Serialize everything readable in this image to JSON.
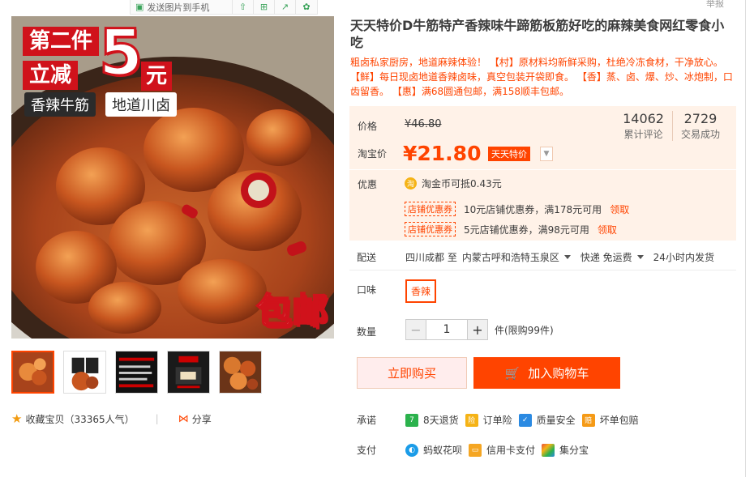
{
  "toolbar": {
    "send_to_phone": "发送图片到手机",
    "top_right_link": "举报"
  },
  "main_image": {
    "promo_line1": "第二件",
    "promo_line2": "立减",
    "promo_big": "5",
    "promo_yuan": "元",
    "tag_spicy": "香辣牛筋",
    "tag_local": "地道川卤",
    "tag_free_shipping": "包邮"
  },
  "thumbnails": [
    "thumb-1",
    "thumb-2",
    "thumb-3",
    "thumb-4",
    "thumb-5"
  ],
  "favorite": {
    "label": "收藏宝贝",
    "count": "（33365人气）",
    "share": "分享"
  },
  "product": {
    "title": "天天特价D牛筋特产香辣味牛蹄筋板筋好吃的麻辣美食网红零食小吃",
    "subtitle": "粗卤私家厨房，地道麻辣体验！ 【村】原材料均新鲜采购，杜绝冷冻食材，干净放心。【鲜】每日现卤地道香辣卤味，真空包装开袋即食。 【香】蒸、卤、爆、炒、冰炮制，口齿留香。 【惠】满68圆通包邮，满158顺丰包邮。"
  },
  "price": {
    "label": "价格",
    "original": "¥46.80",
    "tb_label": "淘宝价",
    "current": "¥21.80",
    "badge": "天天特价"
  },
  "stats": {
    "reviews_num": "14062",
    "reviews_label": "累计评论",
    "deals_num": "2729",
    "deals_label": "交易成功"
  },
  "promo": {
    "label": "优惠",
    "coin_icon": "淘",
    "coin_text": "淘金币可抵0.43元",
    "coupons": [
      {
        "tag": "店铺优惠券",
        "text": "10元店铺优惠券，满178元可用",
        "get": "领取"
      },
      {
        "tag": "店铺优惠券",
        "text": "5元店铺优惠券，满98元可用",
        "get": "领取"
      }
    ]
  },
  "delivery": {
    "label": "配送",
    "from": "四川成都 至",
    "to": "内蒙古呼和浩特玉泉区",
    "method": "快递 免运费",
    "dispatch": "24小时内发货"
  },
  "flavor": {
    "label": "口味",
    "option": "香辣"
  },
  "quantity": {
    "label": "数量",
    "minus": "−",
    "value": "1",
    "plus": "+",
    "unit": "件(限购99件)"
  },
  "buttons": {
    "buy_now": "立即购买",
    "add_cart": "加入购物车"
  },
  "promise": {
    "label": "承诺",
    "items": [
      {
        "icon": "7",
        "text": "8天退货"
      },
      {
        "icon": "险",
        "text": "订单险"
      },
      {
        "icon": "✓",
        "text": "质量安全"
      },
      {
        "icon": "赔",
        "text": "坏单包赔"
      }
    ]
  },
  "payment": {
    "label": "支付",
    "items": [
      {
        "text": "蚂蚁花呗"
      },
      {
        "text": "信用卡支付"
      },
      {
        "text": "集分宝"
      }
    ]
  },
  "colors": {
    "accent": "#ff4400",
    "price_bg": "#fff2e8",
    "promo_red": "#d0121b"
  }
}
